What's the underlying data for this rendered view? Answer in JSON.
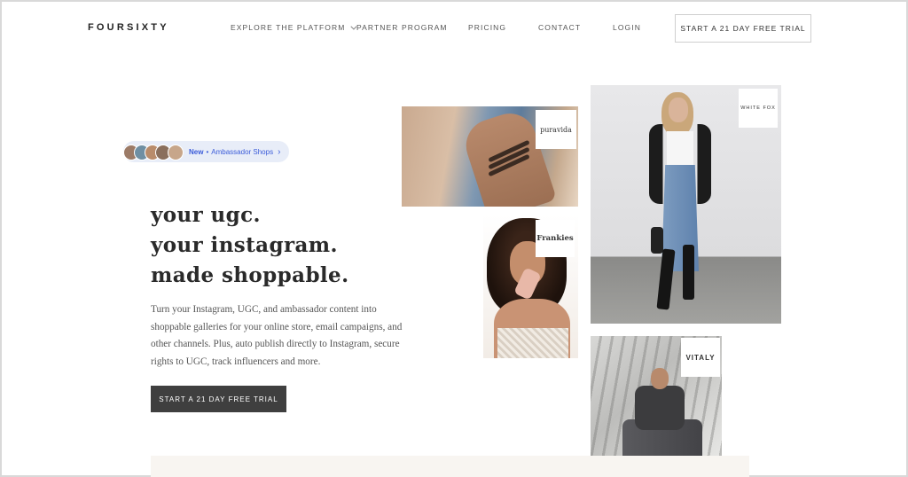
{
  "nav": {
    "logo": "FOURSIXTY",
    "items": [
      {
        "label": "EXPLORE THE PLATFORM",
        "has_dropdown": true
      },
      {
        "label": "PARTNER PROGRAM"
      },
      {
        "label": "PRICING"
      },
      {
        "label": "CONTACT"
      },
      {
        "label": "LOGIN"
      }
    ],
    "cta_label": "START A 21 DAY FREE TRIAL"
  },
  "announcement": {
    "new_label": "New",
    "separator": "•",
    "text": "Ambassador Shops",
    "arrow": "›",
    "avatar_colors": [
      "#9c7b67",
      "#6f8fa3",
      "#b98c6b",
      "#8a6f5c",
      "#c7a68a"
    ]
  },
  "hero": {
    "headline": [
      "your ugc.",
      "your instagram.",
      "made shoppable."
    ],
    "description": "Turn your Instagram, UGC, and ambassador content into shoppable galleries for your online store, email campaigns, and other channels. Plus, auto publish directly to Instagram, secure rights to UGC, track influencers and more.",
    "cta_label": "START A 21 DAY FREE TRIAL"
  },
  "gallery": {
    "tiles": [
      {
        "brand": "puravida"
      },
      {
        "brand": "Frankies"
      },
      {
        "brand": "WHITE FOX"
      },
      {
        "brand": "VITALY"
      }
    ]
  },
  "colors": {
    "pill_bg": "#e8edf8",
    "pill_text": "#3a5bd9",
    "cta_dark": "#3f3f3f",
    "text_dark": "#2a2a2a"
  }
}
